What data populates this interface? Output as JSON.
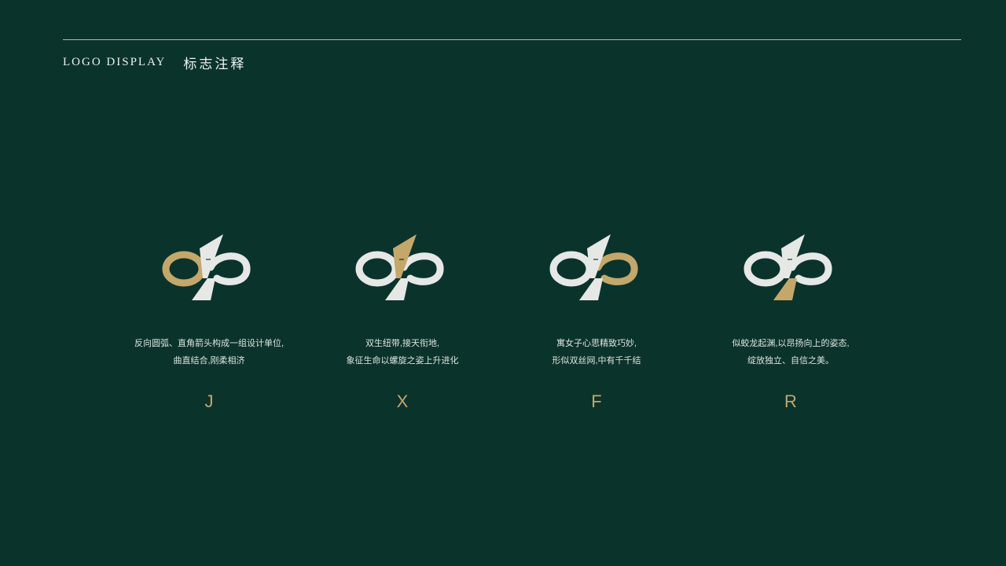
{
  "header": {
    "title_en": "LOGO DISPLAY",
    "title_cn": "标志注释"
  },
  "colors": {
    "background": "#0a332c",
    "gold": "#c4a76a",
    "silver": "#e6e8e6"
  },
  "cards": [
    {
      "desc_line1": "反向圆弧、直角箭头构成一组设计单位,",
      "desc_line2": "曲直结合,刚柔相济",
      "letter": "J",
      "highlight": "left-loop"
    },
    {
      "desc_line1": "双生纽带,接天衔地,",
      "desc_line2": "象征生命以螺旋之姿上升进化",
      "letter": "X",
      "highlight": "top-stroke"
    },
    {
      "desc_line1": "寓女子心思精致巧妙,",
      "desc_line2": "形似双丝网,中有千千结",
      "letter": "F",
      "highlight": "right-loop"
    },
    {
      "desc_line1": "似蛟龙起渊,以昂扬向上的姿态,",
      "desc_line2": "绽放独立、自信之美。",
      "letter": "R",
      "highlight": "descender"
    }
  ]
}
